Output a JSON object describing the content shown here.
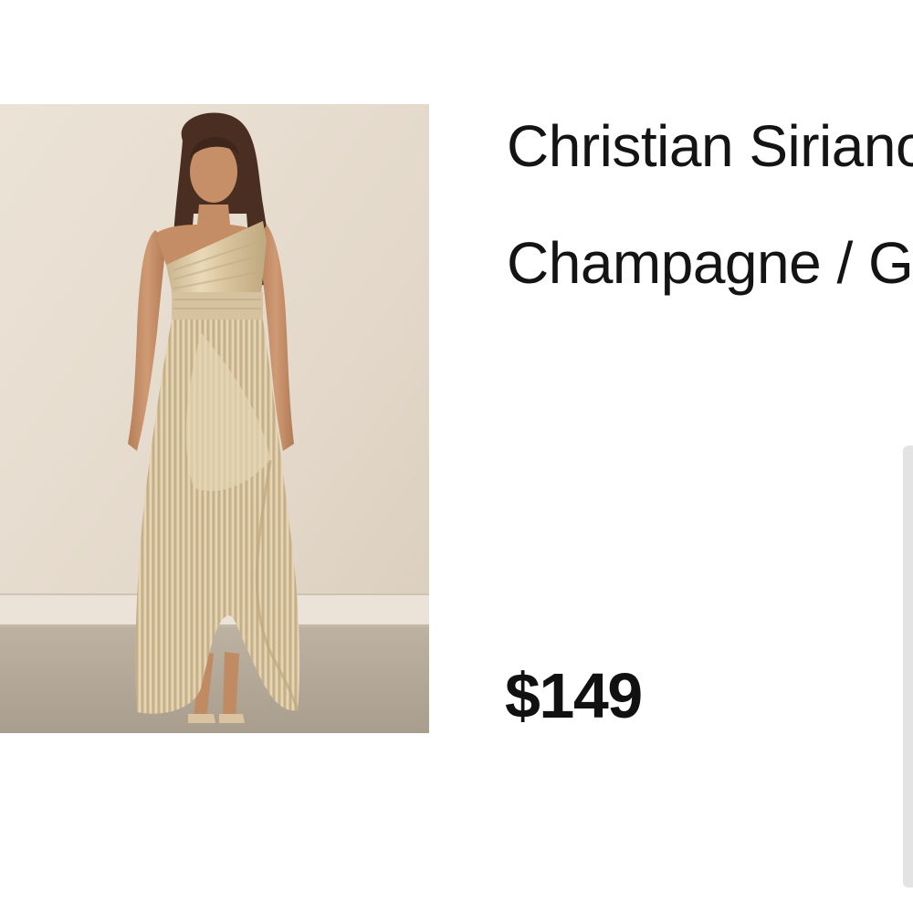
{
  "product": {
    "title": "Christian Siriano",
    "color": "Champagne / Gold",
    "price": "$149"
  },
  "image": {
    "subject": "one-shoulder pleated satin gown",
    "palette": {
      "wall": "#e6dccf",
      "floor": "#b5aa9a",
      "dress": "#dcc9a4",
      "skin": "#c8916a",
      "hair": "#4a2e22"
    }
  }
}
